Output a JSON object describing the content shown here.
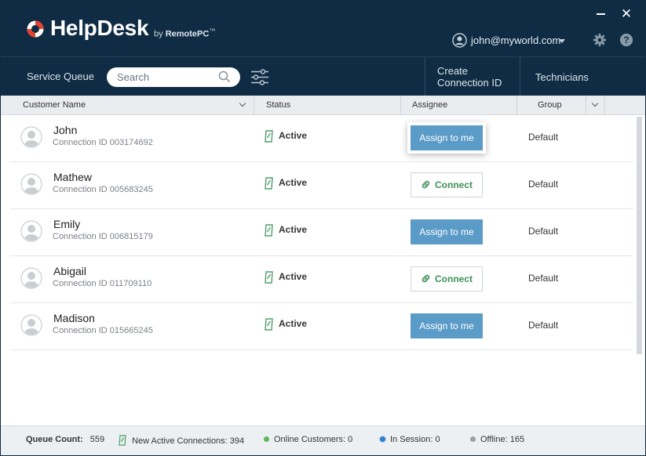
{
  "app": {
    "brand": "HelpDesk",
    "by_prefix": "by",
    "by_name": "RemotePC",
    "tm": "™"
  },
  "window": {
    "minimize_label": "",
    "close_label": "✕"
  },
  "user": {
    "email": "john@myworld.com"
  },
  "nav": {
    "service_queue": "Service Queue",
    "search_placeholder": "Search",
    "create_line1": "Create",
    "create_line2": "Connection ID",
    "technicians": "Technicians"
  },
  "columns": {
    "customer_name": "Customer Name",
    "status": "Status",
    "assignee": "Assignee",
    "group": "Group"
  },
  "rows": [
    {
      "name": "John",
      "connection": "Connection ID 003174692",
      "status": "Active",
      "action": "Assign to me",
      "action_type": "assign",
      "focused": true,
      "group": "Default"
    },
    {
      "name": "Mathew",
      "connection": "Connection ID 005683245",
      "status": "Active",
      "action": "Connect",
      "action_type": "connect",
      "focused": false,
      "group": "Default"
    },
    {
      "name": "Emily",
      "connection": "Connection ID 006815179",
      "status": "Active",
      "action": "Assign to me",
      "action_type": "assign",
      "focused": false,
      "group": "Default"
    },
    {
      "name": "Abigail",
      "connection": "Connection ID 011709110",
      "status": "Active",
      "action": "Connect",
      "action_type": "connect",
      "focused": false,
      "group": "Default"
    },
    {
      "name": "Madison",
      "connection": "Connection ID 015665245",
      "status": "Active",
      "action": "Assign to me",
      "action_type": "assign",
      "focused": false,
      "group": "Default"
    }
  ],
  "footer": {
    "queue_count_label": "Queue Count:",
    "queue_count": "559",
    "new_active": "New Active Connections: 394",
    "online": "Online Customers: 0",
    "in_session": "In Session: 0",
    "offline": "Offline: 165"
  },
  "colors": {
    "header_bg": "#0f2c44",
    "assign_button": "#5b9bc8",
    "connect_text": "#3f8f5a",
    "logo_red": "#e8412c",
    "online_dot": "#5cb85c",
    "in_session_dot": "#2f7fd0",
    "offline_dot": "#9aa0a6"
  }
}
